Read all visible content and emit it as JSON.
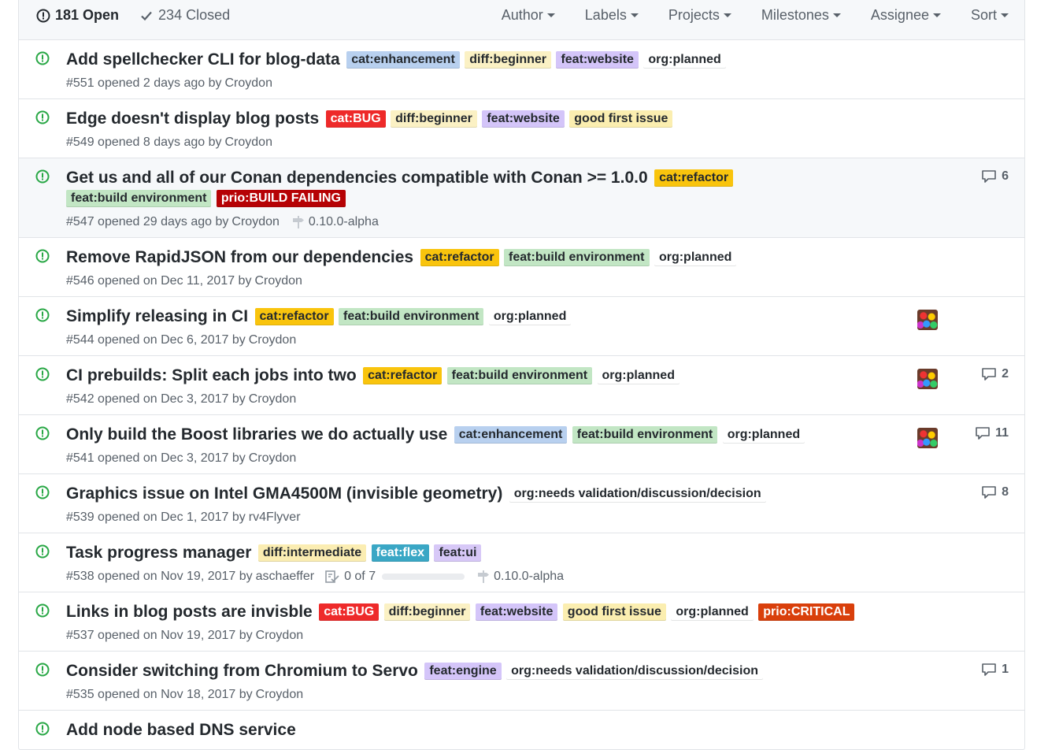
{
  "header": {
    "open_count": "181 Open",
    "closed_count": "234 Closed",
    "filters": [
      "Author",
      "Labels",
      "Projects",
      "Milestones",
      "Assignee",
      "Sort"
    ]
  },
  "colors": {
    "open_icon": "#28a745",
    "cat:enhancement": {
      "bg": "#b8d0ef",
      "fg": "#24292e"
    },
    "diff:beginner": {
      "bg": "#fbf1c4",
      "fg": "#24292e"
    },
    "feat:website": {
      "bg": "#d4c5f9",
      "fg": "#24292e"
    },
    "org:planned": {
      "bg": "#ffffff",
      "fg": "#24292e"
    },
    "cat:BUG": {
      "bg": "#ee2a2a",
      "fg": "#ffffff"
    },
    "good first issue": {
      "bg": "#fbeeb0",
      "fg": "#24292e"
    },
    "cat:refactor": {
      "bg": "#f9c40d",
      "fg": "#24292e"
    },
    "feat:build environment": {
      "bg": "#c2e6c4",
      "fg": "#24292e"
    },
    "prio:BUILD FAILING": {
      "bg": "#b60205",
      "fg": "#ffffff"
    },
    "org:needs validation/discussion/decision": {
      "bg": "#ffffff",
      "fg": "#24292e"
    },
    "diff:intermediate": {
      "bg": "#fbedb2",
      "fg": "#24292e"
    },
    "feat:flex": {
      "bg": "#3aa7c5",
      "fg": "#ffffff"
    },
    "feat:ui": {
      "bg": "#d7c8f7",
      "fg": "#24292e"
    },
    "prio:CRITICAL": {
      "bg": "#d93f0b",
      "fg": "#ffffff"
    },
    "feat:engine": {
      "bg": "#d4c5f9",
      "fg": "#24292e"
    }
  },
  "issues": [
    {
      "title": "Add spellchecker CLI for blog-data",
      "labels": [
        "cat:enhancement",
        "diff:beginner",
        "feat:website",
        "org:planned"
      ],
      "meta": "#551 opened 2 days ago by",
      "author": "Croydon",
      "comments": "",
      "avatar": false
    },
    {
      "title": "Edge doesn't display blog posts",
      "labels": [
        "cat:BUG",
        "diff:beginner",
        "feat:website",
        "good first issue"
      ],
      "meta": "#549 opened 8 days ago by",
      "author": "Croydon",
      "comments": "",
      "avatar": false
    },
    {
      "title": "Get us and all of our Conan dependencies compatible with Conan >= 1.0.0",
      "labels": [
        "cat:refactor",
        "feat:build environment",
        "prio:BUILD FAILING"
      ],
      "meta": "#547 opened 29 days ago by",
      "author": "Croydon",
      "milestone": "0.10.0-alpha",
      "comments": "6",
      "avatar": false,
      "highlight": true
    },
    {
      "title": "Remove RapidJSON from our dependencies",
      "labels": [
        "cat:refactor",
        "feat:build environment",
        "org:planned"
      ],
      "meta": "#546 opened on Dec 11, 2017 by",
      "author": "Croydon",
      "comments": "",
      "avatar": false
    },
    {
      "title": "Simplify releasing in CI",
      "labels": [
        "cat:refactor",
        "feat:build environment",
        "org:planned"
      ],
      "meta": "#544 opened on Dec 6, 2017 by",
      "author": "Croydon",
      "comments": "",
      "avatar": true
    },
    {
      "title": "CI prebuilds: Split each jobs into two",
      "labels": [
        "cat:refactor",
        "feat:build environment",
        "org:planned"
      ],
      "meta": "#542 opened on Dec 3, 2017 by",
      "author": "Croydon",
      "comments": "2",
      "avatar": true
    },
    {
      "title": "Only build the Boost libraries we do actually use",
      "labels": [
        "cat:enhancement",
        "feat:build environment",
        "org:planned"
      ],
      "meta": "#541 opened on Dec 3, 2017 by",
      "author": "Croydon",
      "comments": "11",
      "avatar": true
    },
    {
      "title": "Graphics issue on Intel GMA4500M (invisible geometry)",
      "labels": [
        "org:needs validation/discussion/decision"
      ],
      "meta": "#539 opened on Dec 1, 2017 by",
      "author": "rv4Flyver",
      "comments": "8",
      "avatar": false
    },
    {
      "title": "Task progress manager",
      "labels": [
        "diff:intermediate",
        "feat:flex",
        "feat:ui"
      ],
      "meta": "#538 opened on Nov 19, 2017 by",
      "author": "aschaeffer",
      "tasks": "0 of 7",
      "tasks_progress": 0,
      "milestone": "0.10.0-alpha",
      "comments": "",
      "avatar": false
    },
    {
      "title": "Links in blog posts are invisble",
      "labels": [
        "cat:BUG",
        "diff:beginner",
        "feat:website",
        "good first issue",
        "org:planned",
        "prio:CRITICAL"
      ],
      "meta": "#537 opened on Nov 19, 2017 by",
      "author": "Croydon",
      "comments": "",
      "avatar": false
    },
    {
      "title": "Consider switching from Chromium to Servo",
      "labels": [
        "feat:engine",
        "org:needs validation/discussion/decision"
      ],
      "meta": "#535 opened on Nov 18, 2017 by",
      "author": "Croydon",
      "comments": "1",
      "avatar": false
    },
    {
      "title": "Add node based DNS service",
      "labels": [],
      "meta": "",
      "author": "",
      "comments": "",
      "avatar": false
    }
  ]
}
